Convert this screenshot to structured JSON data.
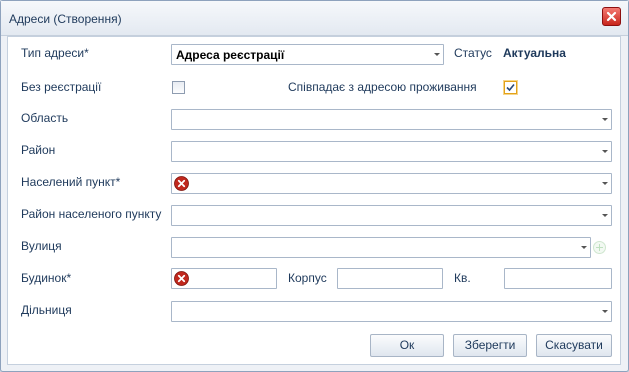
{
  "window": {
    "title": "Адреси (Створення)"
  },
  "form": {
    "address_type": {
      "label": "Тип адреси*",
      "value": "Адреса реєстрації"
    },
    "status": {
      "label": "Статус",
      "value": "Актуальна"
    },
    "no_registration": {
      "label": "Без реєстрації",
      "checked": false
    },
    "same_as_residence": {
      "label": "Співпадає з адресою проживання",
      "checked": true
    },
    "region": {
      "label": "Область",
      "value": ""
    },
    "district": {
      "label": "Район",
      "value": ""
    },
    "locality": {
      "label": "Населений пункт*",
      "value": "",
      "error": true
    },
    "locality_district": {
      "label": "Район населеного пункту",
      "value": ""
    },
    "street": {
      "label": "Вулиця",
      "value": ""
    },
    "building": {
      "label": "Будинок*",
      "value": "",
      "error": true
    },
    "block": {
      "label": "Корпус",
      "value": ""
    },
    "apartment": {
      "label": "Кв.",
      "value": ""
    },
    "precinct": {
      "label": "Дільниця",
      "value": ""
    }
  },
  "buttons": {
    "ok": "Ок",
    "save": "Зберегти",
    "cancel": "Скасувати"
  },
  "colors": {
    "accent": "#1e395b",
    "error": "#c0281e",
    "checkbox_highlight": "#e3a21a"
  }
}
